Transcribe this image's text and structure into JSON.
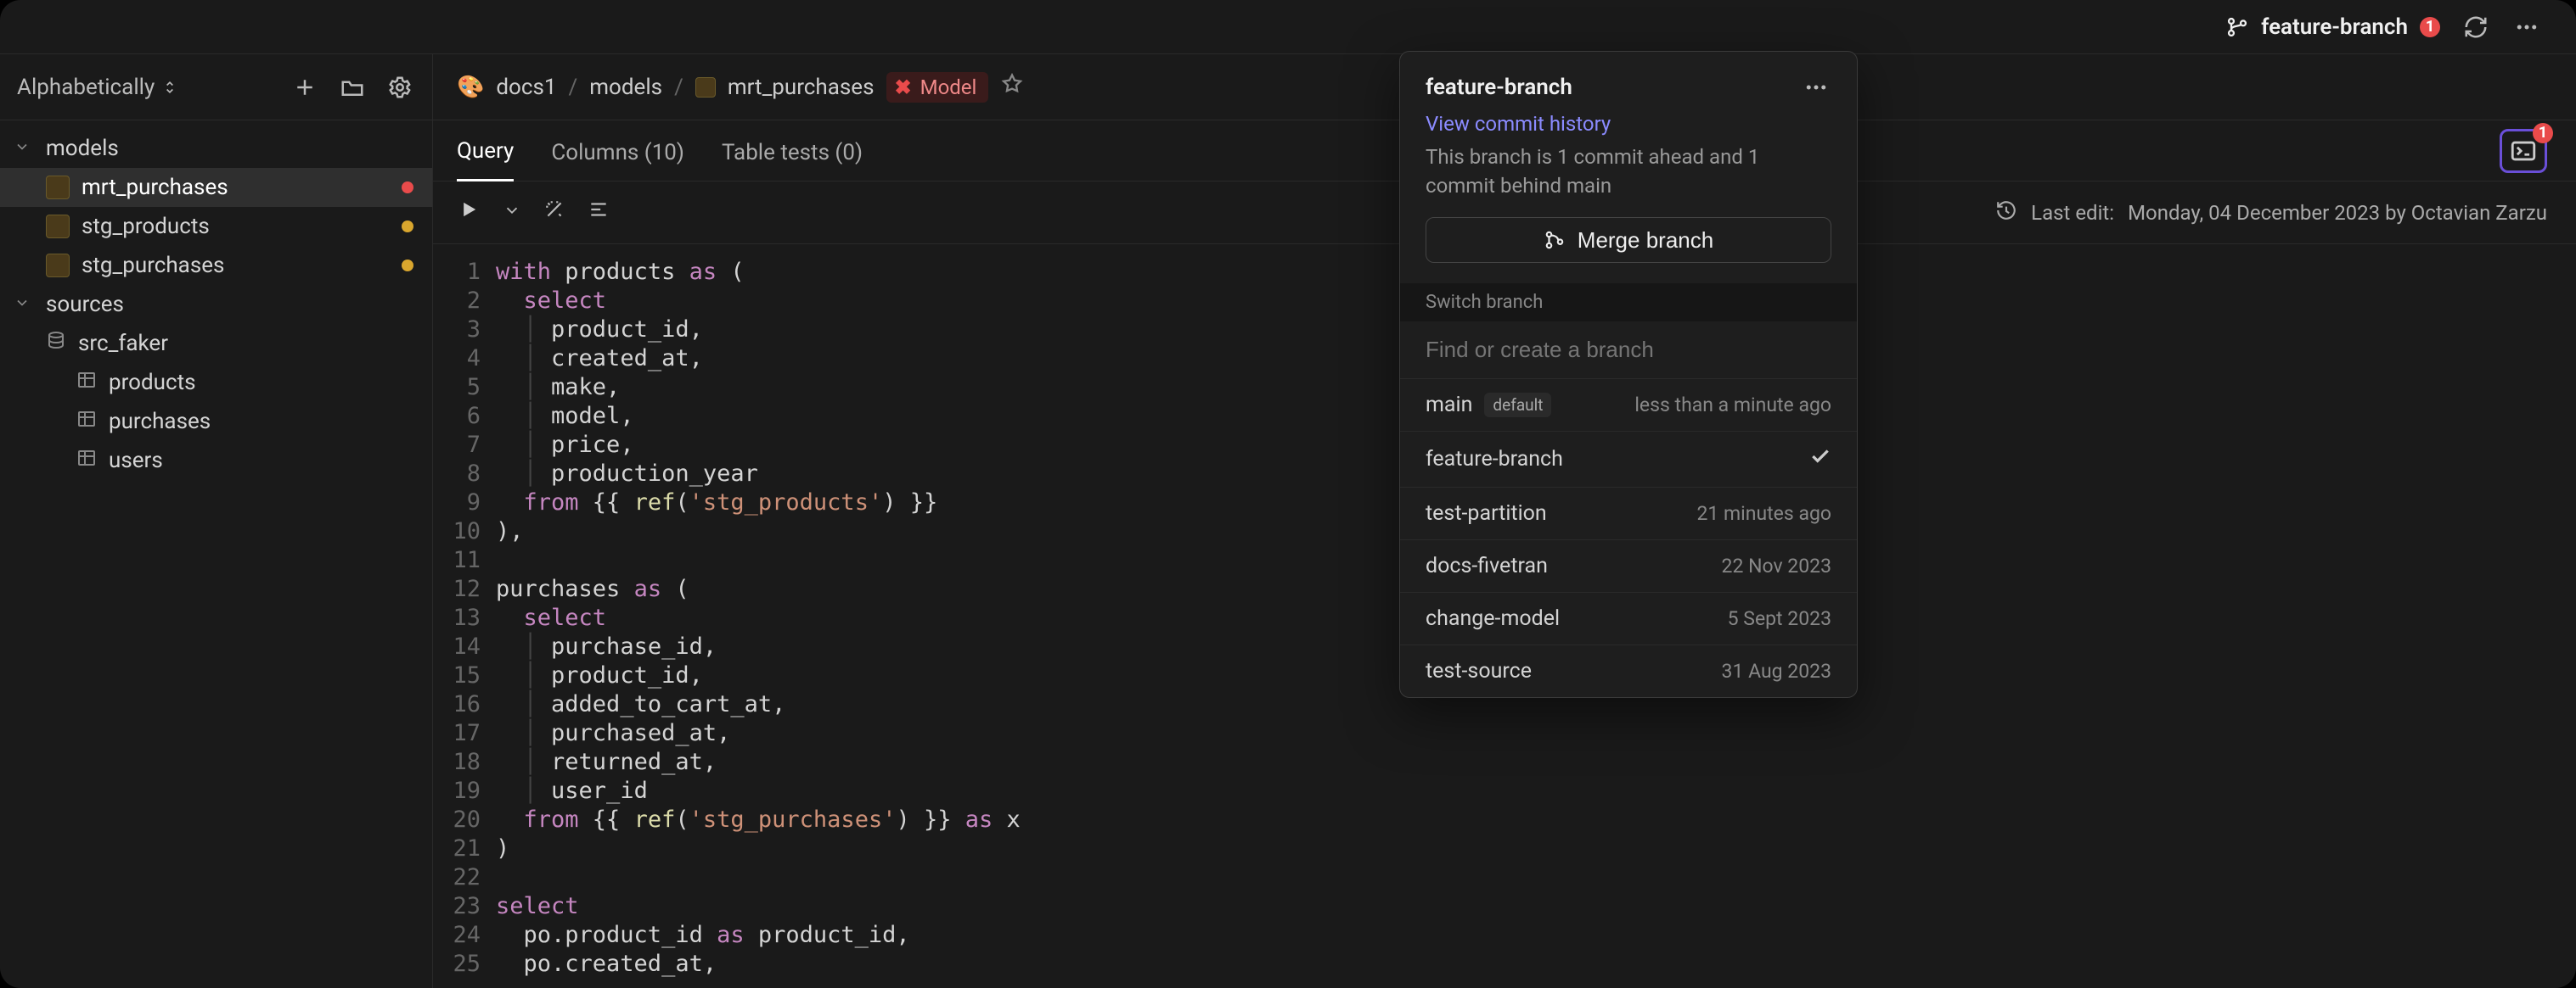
{
  "topbar": {
    "branch_name": "feature-branch",
    "badge_count": "1"
  },
  "sidebar": {
    "sort_label": "Alphabetically",
    "groups": {
      "models": {
        "label": "models",
        "items": [
          {
            "label": "mrt_purchases",
            "status": "red"
          },
          {
            "label": "stg_products",
            "status": "yellow"
          },
          {
            "label": "stg_purchases",
            "status": "yellow"
          }
        ]
      },
      "sources": {
        "label": "sources",
        "child_label": "src_faker",
        "tables": [
          {
            "label": "products"
          },
          {
            "label": "purchases"
          },
          {
            "label": "users"
          }
        ]
      }
    }
  },
  "breadcrumbs": {
    "root_emoji": "🎨",
    "root": "docs1",
    "models": "models",
    "file": "mrt_purchases",
    "tag_label": "Model"
  },
  "tabs": {
    "query": "Query",
    "columns": "Columns (10)",
    "table_tests": "Table tests (0)",
    "run_badge": "1"
  },
  "last_edit": {
    "prefix": "Last edit:",
    "text": "Monday, 04 December 2023 by Octavian Zarzu"
  },
  "popover": {
    "title": "feature-branch",
    "view_history": "View commit history",
    "status": "This branch is 1 commit ahead and 1 commit behind main",
    "merge_label": "Merge branch",
    "switch_label": "Switch branch",
    "search_placeholder": "Find or create a branch",
    "branches": {
      "main": {
        "name": "main",
        "default_label": "default",
        "meta": "less than a minute ago"
      },
      "feature": {
        "name": "feature-branch",
        "meta": ""
      },
      "partition": {
        "name": "test-partition",
        "meta": "21 minutes ago"
      },
      "fivetran": {
        "name": "docs-fivetran",
        "meta": "22 Nov 2023"
      },
      "changemodel": {
        "name": "change-model",
        "meta": "5 Sept 2023"
      },
      "testsource": {
        "name": "test-source",
        "meta": "31 Aug 2023"
      }
    }
  },
  "code": {
    "lines": [
      "with products as (",
      "  select",
      "    product_id,",
      "    created_at,",
      "    make,",
      "    model,",
      "    price,",
      "    production_year",
      "  from {{ ref('stg_products') }}",
      "),",
      "",
      "purchases as (",
      "  select",
      "    purchase_id,",
      "    product_id,",
      "    added_to_cart_at,",
      "    purchased_at,",
      "    returned_at,",
      "    user_id",
      "  from {{ ref('stg_purchases') }} as x",
      ")",
      "",
      "select",
      "  po.product_id as product_id,",
      "  po.created_at,"
    ]
  }
}
